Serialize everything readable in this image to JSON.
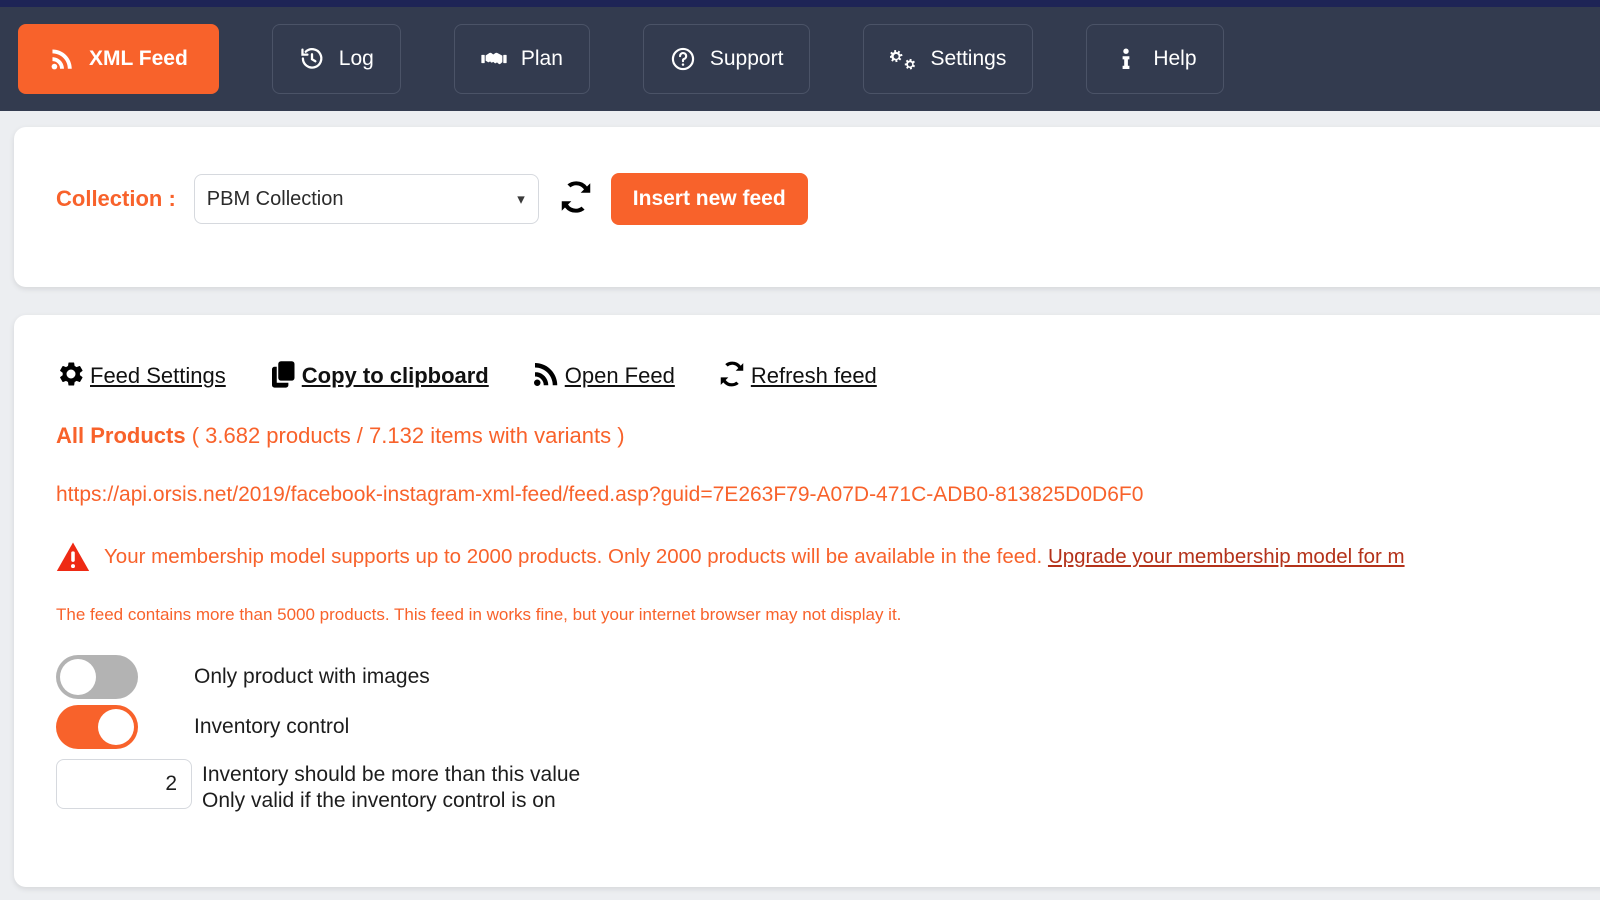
{
  "theme": {
    "accent": "#f8622b",
    "navbar_bg": "#333b4f",
    "top_strip": "#1e2456",
    "page_bg": "#eceef1",
    "toggle_off": "#b3b3b3"
  },
  "navbar": {
    "items": [
      {
        "label": "XML Feed",
        "icon": "rss-icon",
        "active": true
      },
      {
        "label": "Log",
        "icon": "history-icon",
        "active": false
      },
      {
        "label": "Plan",
        "icon": "handshake-icon",
        "active": false
      },
      {
        "label": "Support",
        "icon": "question-circle-icon",
        "active": false
      },
      {
        "label": "Settings",
        "icon": "gears-icon",
        "active": false
      },
      {
        "label": "Help",
        "icon": "info-icon",
        "active": false
      }
    ]
  },
  "collection": {
    "label": "Collection :",
    "selected": "PBM Collection",
    "options": [
      "PBM Collection"
    ],
    "refresh_icon": "refresh-icon",
    "insert_button": "Insert new feed"
  },
  "feed": {
    "actions": [
      {
        "label": "Feed Settings",
        "icon": "gear-icon",
        "bold": false
      },
      {
        "label": "Copy to clipboard",
        "icon": "clipboard-icon",
        "bold": true
      },
      {
        "label": "Open Feed",
        "icon": "rss-icon",
        "bold": false
      },
      {
        "label": "Refresh feed",
        "icon": "refresh-icon",
        "bold": false
      }
    ],
    "products_title": "All Products",
    "products_count": "( 3.682 products / 7.132 items with variants )",
    "url": "https://api.orsis.net/2019/facebook-instagram-xml-feed/feed.asp?guid=7E263F79-A07D-471C-ADB0-813825D0D6F0",
    "warning_icon": "warning-triangle-icon",
    "warning_text": "Your membership model supports up to 2000 products. Only 2000 products will be available in the feed.",
    "warning_link": "Upgrade your membership model for m",
    "note_text": "The feed contains more than 5000 products. This feed in works fine, but your internet browser may not display it.",
    "toggles": [
      {
        "label": "Only product with images",
        "on": false
      },
      {
        "label": "Inventory control",
        "on": true
      }
    ],
    "inventory": {
      "value": "2",
      "label_line1": "Inventory should be more than this value",
      "label_line2": "Only valid if the inventory control is on"
    }
  }
}
